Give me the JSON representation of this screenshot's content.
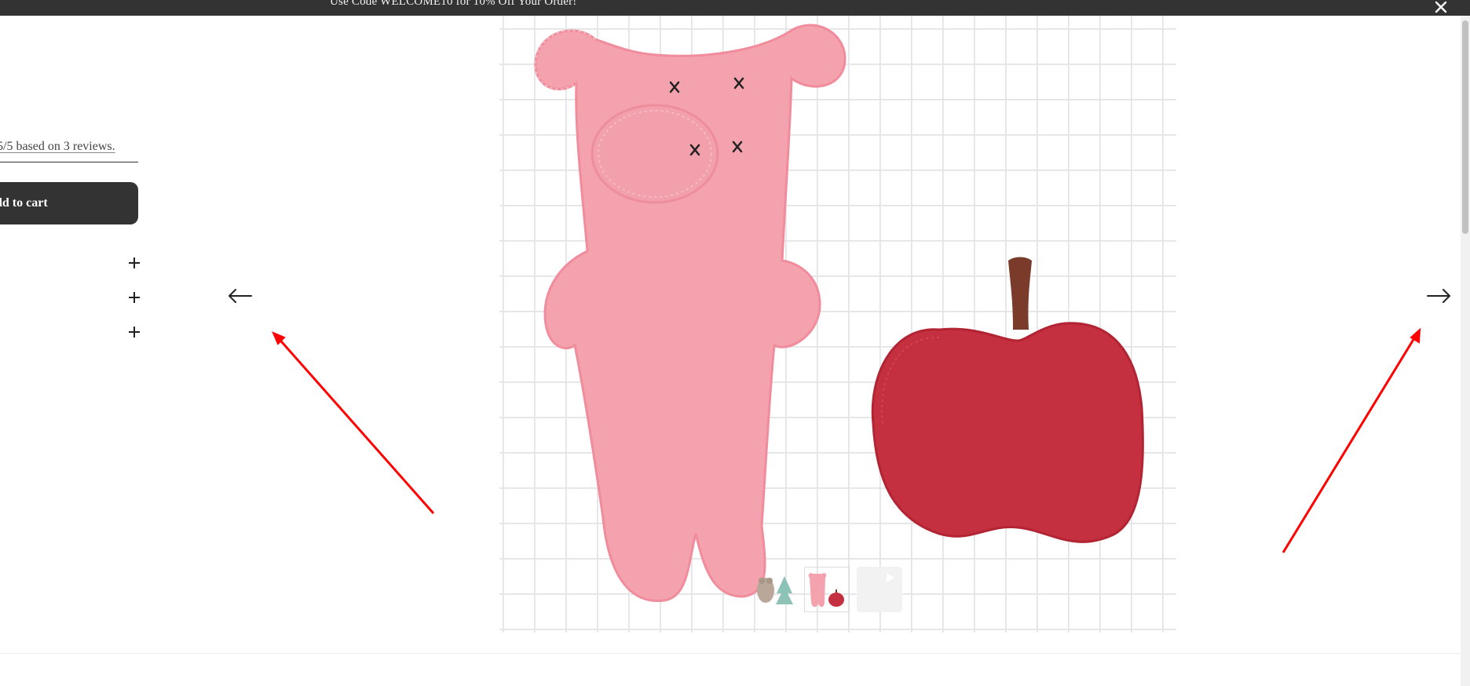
{
  "announcement": {
    "text": "Use Code WELCOME10 for 10% Off Your Order!",
    "close_icon": "close-icon"
  },
  "product": {
    "reviews_text": "5/5 based on 3 reviews.",
    "add_to_cart_label": "dd to cart",
    "expanders": [
      "plus-icon",
      "plus-icon",
      "plus-icon"
    ]
  },
  "gallery": {
    "prev_icon": "arrow-left-icon",
    "next_icon": "arrow-right-icon",
    "main_image": "pink felt pig toy and red felt apple on a grid background",
    "thumbnails": [
      {
        "icon": "bear-and-tree-thumbnail",
        "active": false
      },
      {
        "icon": "pig-and-apple-thumbnail",
        "active": true
      },
      {
        "icon": "video-thumbnail",
        "active": false
      }
    ]
  },
  "colors": {
    "banner_bg": "#333333",
    "button_bg": "#333333",
    "pig_pink": "#f4a0ad",
    "apple_red": "#c52f3e",
    "annotation_red": "#ff0000"
  }
}
